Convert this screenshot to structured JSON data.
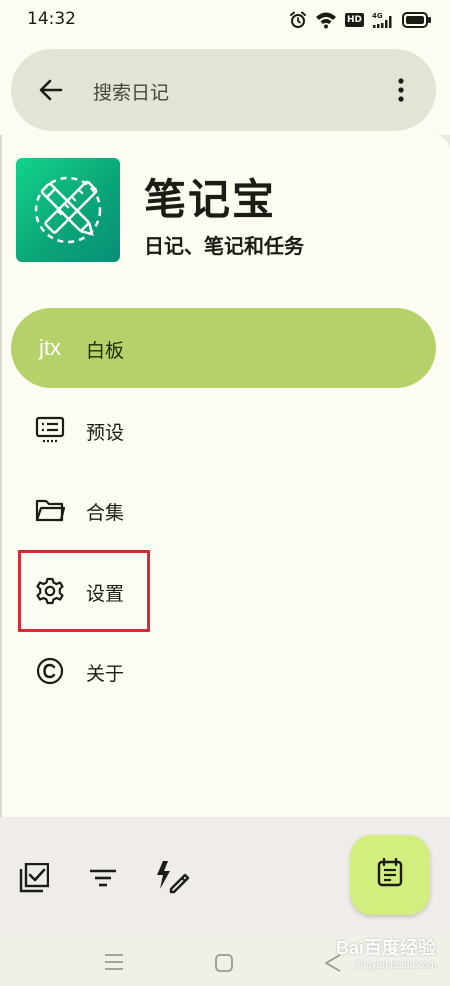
{
  "status_bar": {
    "time": "14:32",
    "hd_badge": "HD",
    "network_label": "4G",
    "icons": [
      "alarm-icon",
      "wifi-icon",
      "hd-icon",
      "signal-icon",
      "battery-icon"
    ]
  },
  "search": {
    "placeholder": "搜索日记"
  },
  "app": {
    "title": "笔记宝",
    "subtitle": "日记、笔记和任务"
  },
  "nav": {
    "items": [
      {
        "label": "白板",
        "icon": "jtx-logo-icon",
        "active": true,
        "brand_text": "jtx"
      },
      {
        "label": "预设",
        "icon": "presets-icon",
        "active": false
      },
      {
        "label": "合集",
        "icon": "folder-icon",
        "active": false
      },
      {
        "label": "设置",
        "icon": "gear-icon",
        "active": false
      },
      {
        "label": "关于",
        "icon": "copyright-icon",
        "active": false
      }
    ]
  },
  "bottom_bar": {
    "icons": [
      "checklist-icon",
      "filter-icon",
      "quick-edit-icon"
    ],
    "fab_icon": "journal-icon"
  },
  "system_nav": {
    "icons": [
      "menu-icon",
      "home-icon",
      "back-icon"
    ]
  },
  "watermark": {
    "text": "Bai百度经验",
    "sub": "jingyan.baidu.com"
  },
  "colors": {
    "background": "#fdfcf3",
    "active_nav": "#b6d169",
    "fab": "#d2ee7e",
    "highlight": "#d62b32",
    "logo_green": "#0ba678"
  }
}
